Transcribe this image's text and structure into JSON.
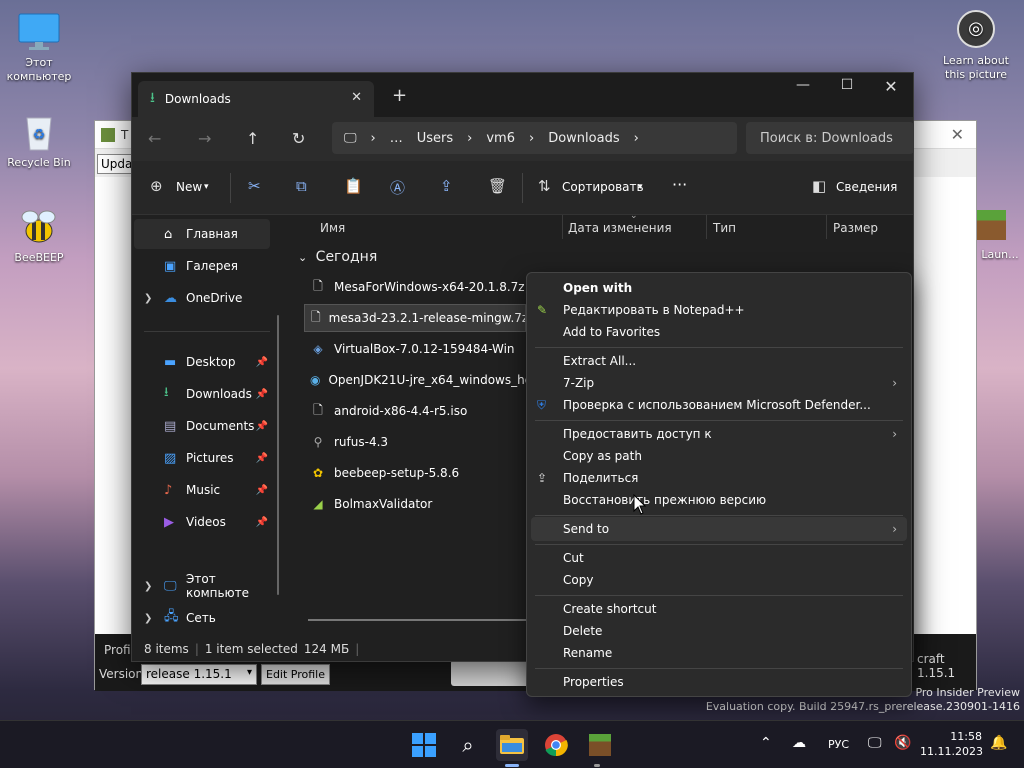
{
  "desktop": {
    "icons": [
      {
        "label": "Этот компьютер",
        "icon": "monitor-icon"
      },
      {
        "label": "Recycle Bin",
        "icon": "recycle-bin-icon"
      },
      {
        "label": "BeeBEEP",
        "icon": "bee-icon"
      }
    ],
    "learn": "Learn about this picture",
    "right_icon_label": "Laun...",
    "watermark_line1": "Pro Insider Preview",
    "watermark_line2": "Evaluation copy. Build 25947.rs_prerelease.230901-1416"
  },
  "launcher": {
    "title": "T",
    "tab": "Updat",
    "profile_label": "Profil",
    "version_label": "Version:",
    "version_value": "release 1.15.1",
    "edit_profile": "Edit Profile",
    "right_text": "craft 1.15.1"
  },
  "explorer": {
    "tab_title": "Downloads",
    "breadcrumb": [
      "…",
      "Users",
      "vm6",
      "Downloads"
    ],
    "search_placeholder": "Поиск в: Downloads",
    "toolbar": {
      "new": "New",
      "sort": "Сортировать",
      "details": "Сведения"
    },
    "columns": [
      "Имя",
      "Дата изменения",
      "Тип",
      "Размер"
    ],
    "group": "Сегодня",
    "nav": {
      "home": "Главная",
      "gallery": "Галерея",
      "onedrive": "OneDrive",
      "desktop": "Desktop",
      "downloads": "Downloads",
      "documents": "Documents",
      "pictures": "Pictures",
      "music": "Music",
      "videos": "Videos",
      "thispc": "Этот компьюте",
      "network": "Сеть"
    },
    "files": [
      "MesaForWindows-x64-20.1.8.7z",
      "mesa3d-23.2.1-release-mingw.7z",
      "VirtualBox-7.0.12-159484-Win",
      "OpenJDK21U-jre_x64_windows_hotspot",
      "android-x86-4.4-r5.iso",
      "rufus-4.3",
      "beebeep-setup-5.8.6",
      "BolmaxValidator"
    ],
    "status": {
      "items": "8 items",
      "selected": "1 item selected",
      "size": "124 МБ"
    }
  },
  "context_menu": {
    "items": [
      "Open with",
      "Редактировать в Notepad++",
      "Add to Favorites",
      "Extract All...",
      "7-Zip",
      "Проверка с использованием Microsoft Defender...",
      "Предоставить доступ к",
      "Copy as path",
      "Поделиться",
      "Восстановить прежнюю версию",
      "Send to",
      "Cut",
      "Copy",
      "Create shortcut",
      "Delete",
      "Rename",
      "Properties"
    ]
  },
  "taskbar": {
    "lang": "РУС",
    "time": "11:58",
    "date": "11.11.2023"
  }
}
